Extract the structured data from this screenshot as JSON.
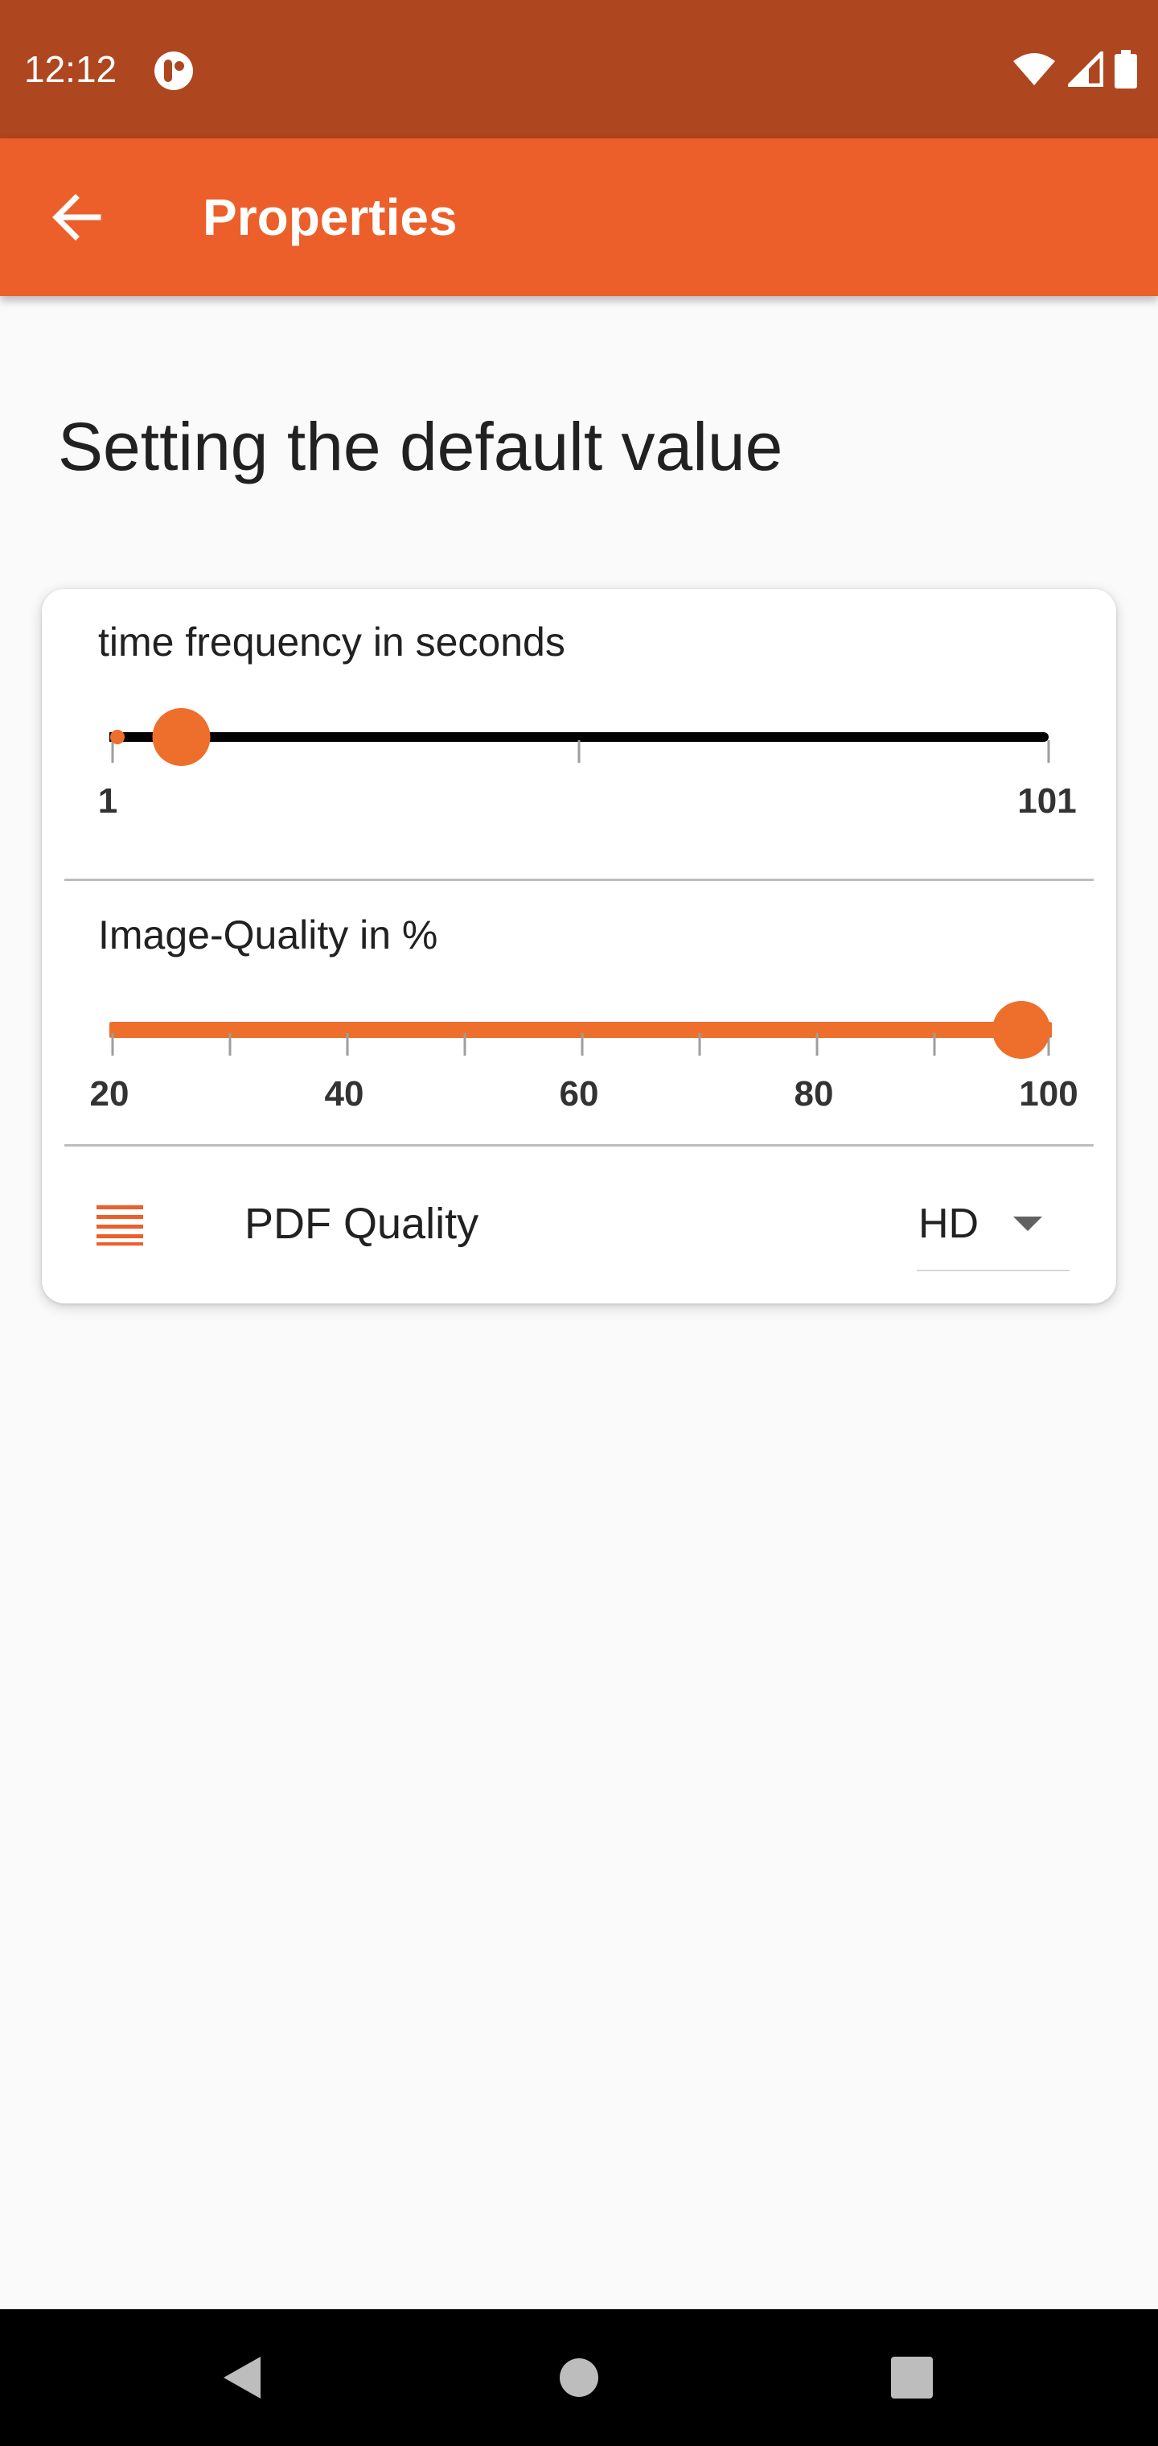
{
  "status_bar": {
    "time": "12:12",
    "icons": [
      "app-notification-icon",
      "wifi-icon",
      "cell-signal-icon",
      "battery-icon"
    ]
  },
  "app_bar": {
    "title": "Properties",
    "back_icon": "arrow-left-icon"
  },
  "page": {
    "heading": "Setting the default value"
  },
  "settings": {
    "time_frequency": {
      "label": "time frequency in seconds",
      "min_label": "1",
      "max_label": "101",
      "min": 1,
      "max": 101,
      "value": 5
    },
    "image_quality": {
      "label": "Image-Quality in %",
      "tick_labels": [
        "20",
        "40",
        "60",
        "80",
        "100"
      ],
      "min": 20,
      "max": 100,
      "value": 100
    },
    "pdf_quality": {
      "label": "PDF Quality",
      "selected": "HD",
      "icon": "list-icon"
    }
  },
  "nav_bar": {
    "buttons": [
      "back-triangle-icon",
      "home-circle-icon",
      "recents-square-icon"
    ]
  },
  "colors": {
    "accent": "#ec5f2b",
    "slider_orange": "#ee6e2c",
    "status_bar": "#ae461f",
    "track_black": "#000000"
  }
}
